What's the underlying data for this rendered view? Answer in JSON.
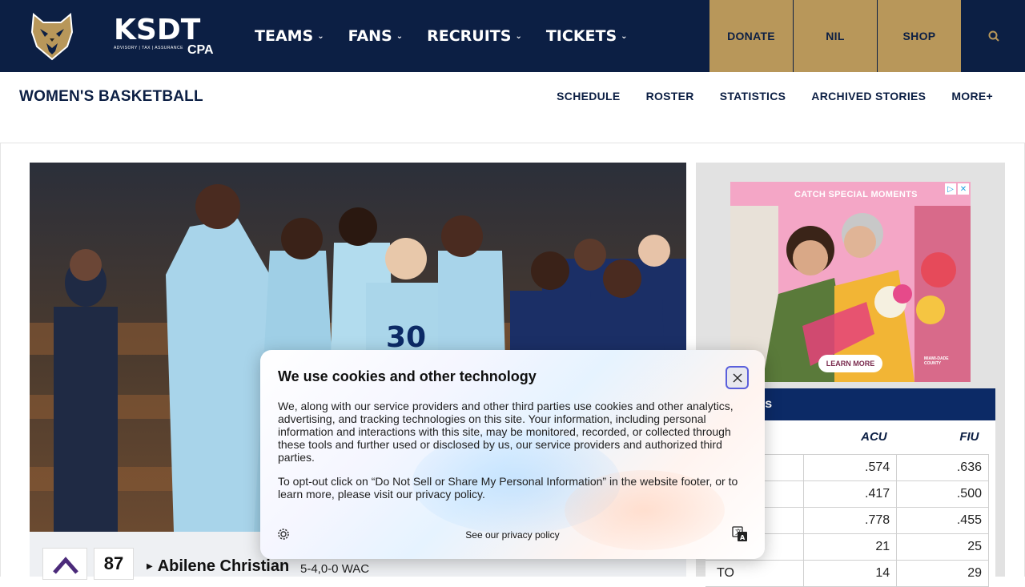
{
  "header": {
    "sponsor": {
      "name": "KSDT",
      "tagline": "ADVISORY | TAX | ASSURANCE",
      "suffix": "CPA"
    },
    "nav": [
      {
        "label": "TEAMS"
      },
      {
        "label": "FANS"
      },
      {
        "label": "RECRUITS"
      },
      {
        "label": "TICKETS"
      }
    ],
    "buttons": {
      "donate": "DONATE",
      "nil": "NIL",
      "shop": "SHOP"
    },
    "colors": {
      "navy": "#0c1f44",
      "gold": "#b8975a"
    }
  },
  "subnav": {
    "sport": "WOMEN'S BASKETBALL",
    "links": [
      "SCHEDULE",
      "ROSTER",
      "STATISTICS",
      "ARCHIVED STORIES",
      "MORE+"
    ]
  },
  "game": {
    "team": "Abilene Christian",
    "score": "87",
    "record": "5-4,0-0 WAC"
  },
  "ad": {
    "tagline": "CATCH SPECIAL MOMENTS",
    "cta": "LEARN MORE",
    "brand": "MIAMI-DADE COUNTY"
  },
  "stats": {
    "title": "Statistics",
    "title_visible": "Statistics",
    "columns": [
      "",
      "ACU",
      "FIU"
    ],
    "rows": [
      {
        "label": "",
        "acu": ".574",
        "fiu": ".636"
      },
      {
        "label": "",
        "acu": ".417",
        "fiu": ".500"
      },
      {
        "label": "",
        "acu": ".778",
        "fiu": ".455"
      },
      {
        "label": "",
        "acu": "21",
        "fiu": "25"
      },
      {
        "label": "TO",
        "acu": "14",
        "fiu": "29"
      }
    ]
  },
  "cookie": {
    "title": "We use cookies and other technology",
    "body1": "We, along with our service providers and other third parties use cookies and other analytics, advertising, and tracking technologies on this site. Your information, including personal information and interactions with this site, may be monitored, recorded, or collected through these tools and further used or disclosed by us, our service providers and authorized third parties.",
    "body2": "To opt-out click on “Do Not Sell or Share My Personal Information” in the website footer, or to learn more, please visit our privacy policy.",
    "policy_link": "See our privacy policy"
  }
}
